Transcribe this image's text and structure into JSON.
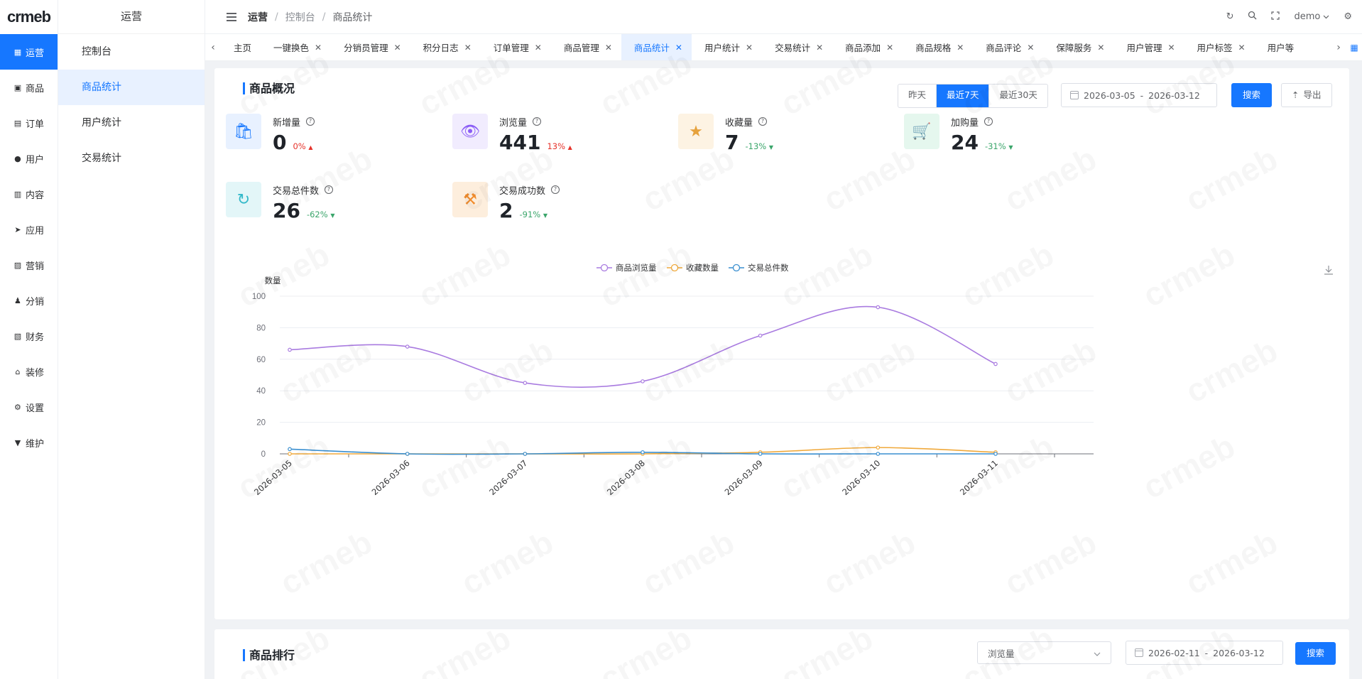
{
  "logo": "crmeb",
  "primary_nav": [
    {
      "label": "运营",
      "icon": "grid-icon",
      "glyph": "▦",
      "active": true
    },
    {
      "label": "商品",
      "icon": "shop-icon",
      "glyph": "▣",
      "active": false
    },
    {
      "label": "订单",
      "icon": "order-icon",
      "glyph": "▤",
      "active": false
    },
    {
      "label": "用户",
      "icon": "user-icon",
      "glyph": "●",
      "active": false
    },
    {
      "label": "内容",
      "icon": "content-icon",
      "glyph": "▥",
      "active": false
    },
    {
      "label": "应用",
      "icon": "send-icon",
      "glyph": "➤",
      "active": false
    },
    {
      "label": "营销",
      "icon": "chart-icon",
      "glyph": "▨",
      "active": false
    },
    {
      "label": "分销",
      "icon": "distribution-icon",
      "glyph": "♟",
      "active": false
    },
    {
      "label": "财务",
      "icon": "finance-icon",
      "glyph": "▧",
      "active": false
    },
    {
      "label": "装修",
      "icon": "home-icon",
      "glyph": "⌂",
      "active": false
    },
    {
      "label": "设置",
      "icon": "gear-icon",
      "glyph": "⚙",
      "active": false
    },
    {
      "label": "维护",
      "icon": "maintain-icon",
      "glyph": "▼",
      "active": false
    }
  ],
  "secondary": {
    "title": "运营",
    "items": [
      {
        "label": "控制台",
        "active": false
      },
      {
        "label": "商品统计",
        "active": true
      },
      {
        "label": "用户统计",
        "active": false
      },
      {
        "label": "交易统计",
        "active": false
      }
    ]
  },
  "header": {
    "breadcrumb": [
      "运营",
      "控制台",
      "商品统计"
    ],
    "user": "demo"
  },
  "tabs": [
    {
      "label": "主页",
      "closable": false,
      "active": false
    },
    {
      "label": "一键换色",
      "closable": true,
      "active": false
    },
    {
      "label": "分销员管理",
      "closable": true,
      "active": false
    },
    {
      "label": "积分日志",
      "closable": true,
      "active": false
    },
    {
      "label": "订单管理",
      "closable": true,
      "active": false
    },
    {
      "label": "商品管理",
      "closable": true,
      "active": false
    },
    {
      "label": "商品统计",
      "closable": true,
      "active": true
    },
    {
      "label": "用户统计",
      "closable": true,
      "active": false
    },
    {
      "label": "交易统计",
      "closable": true,
      "active": false
    },
    {
      "label": "商品添加",
      "closable": true,
      "active": false
    },
    {
      "label": "商品规格",
      "closable": true,
      "active": false
    },
    {
      "label": "商品评论",
      "closable": true,
      "active": false
    },
    {
      "label": "保障服务",
      "closable": true,
      "active": false
    },
    {
      "label": "用户管理",
      "closable": true,
      "active": false
    },
    {
      "label": "用户标签",
      "closable": true,
      "active": false
    },
    {
      "label": "用户等",
      "closable": false,
      "active": false
    }
  ],
  "overview": {
    "title": "商品概况",
    "ranges": [
      "昨天",
      "最近7天",
      "最近30天"
    ],
    "active_range": "最近7天",
    "date_start": "2026-03-05",
    "date_sep": "-",
    "date_end": "2026-03-12",
    "search_label": "搜索",
    "export_label": "导出",
    "stats": [
      {
        "label": "新增量",
        "value": "0",
        "pct": "0%",
        "trend": "up",
        "icon": "bag-plus-icon",
        "glyph": "🛍",
        "color": "#1677ff",
        "bg": "#e8f1ff"
      },
      {
        "label": "浏览量",
        "value": "441",
        "pct": "13%",
        "trend": "up",
        "icon": "eye-icon",
        "glyph": "👁",
        "color": "#8a5cf6",
        "bg": "#f1ecfe"
      },
      {
        "label": "收藏量",
        "value": "7",
        "pct": "-13%",
        "trend": "down",
        "icon": "star-icon",
        "glyph": "★",
        "color": "#e6a23c",
        "bg": "#fdf3e3"
      },
      {
        "label": "加购量",
        "value": "24",
        "pct": "-31%",
        "trend": "down",
        "icon": "cart-icon",
        "glyph": "🛒",
        "color": "#2fb36b",
        "bg": "#e5f7ee"
      },
      {
        "label": "交易总件数",
        "value": "26",
        "pct": "-62%",
        "trend": "down",
        "icon": "refresh-icon",
        "glyph": "↻",
        "color": "#34b9c9",
        "bg": "#e3f6f8"
      },
      {
        "label": "交易成功数",
        "value": "2",
        "pct": "-91%",
        "trend": "down",
        "icon": "gavel-icon",
        "glyph": "⚒",
        "color": "#f08c2e",
        "bg": "#fdeedd"
      }
    ]
  },
  "chart_data": {
    "type": "line",
    "ylabel": "数量",
    "ylim": [
      0,
      100
    ],
    "yticks": [
      0,
      20,
      40,
      60,
      80,
      100
    ],
    "categories": [
      "2026-03-05",
      "2026-03-06",
      "2026-03-07",
      "2026-03-08",
      "2026-03-09",
      "2026-03-10",
      "2026-03-11"
    ],
    "legend_position": "top-center",
    "grid": true,
    "series": [
      {
        "name": "商品浏览量",
        "color": "#a97be0",
        "values": [
          66,
          68,
          45,
          46,
          75,
          93,
          57
        ]
      },
      {
        "name": "收藏数量",
        "color": "#f0a93b",
        "values": [
          0,
          0,
          0,
          0,
          1,
          4,
          1
        ]
      },
      {
        "name": "交易总件数",
        "color": "#3a8fd0",
        "values": [
          3,
          0,
          0,
          1,
          0,
          0,
          0
        ]
      }
    ]
  },
  "ranking": {
    "title": "商品排行",
    "select_value": "浏览量",
    "date_start": "2026-02-11",
    "date_sep": "-",
    "date_end": "2026-03-12",
    "search_label": "搜索"
  }
}
